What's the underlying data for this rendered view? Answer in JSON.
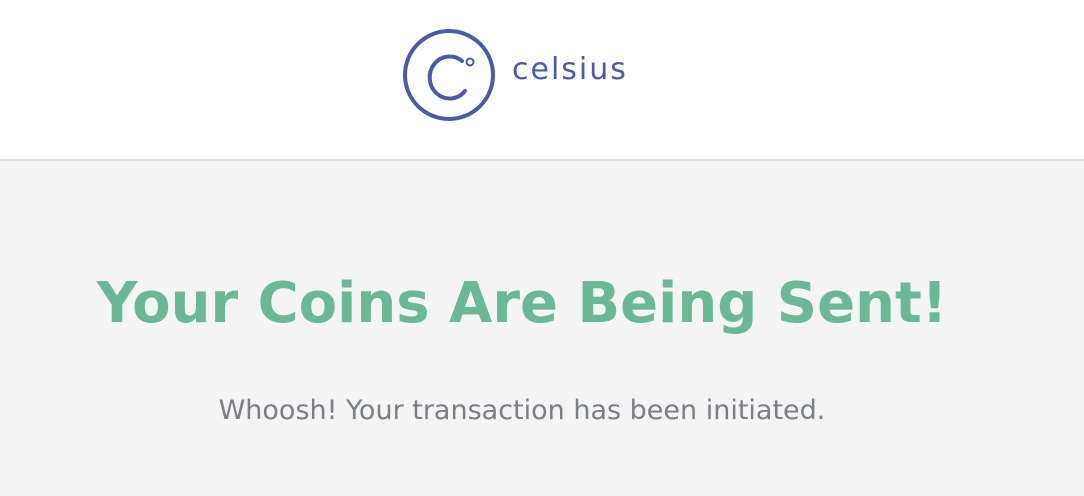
{
  "brand": {
    "name": "celsius",
    "logo_icon": "celsius-c-logo-icon",
    "color": "#4b5aa8"
  },
  "main": {
    "title": "Your Coins Are Being Sent!",
    "subtitle": "Whoosh! Your transaction has been initiated.",
    "title_color": "#6ab895",
    "subtitle_color": "#7a7e87",
    "background": "#f4f4f4"
  }
}
